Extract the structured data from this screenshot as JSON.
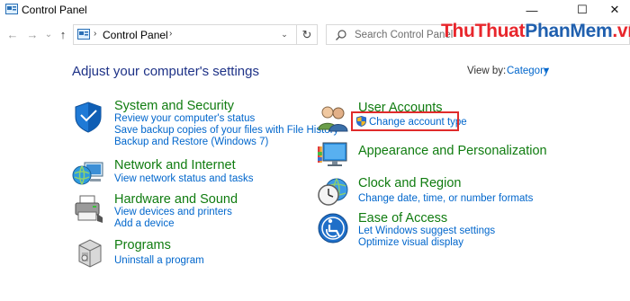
{
  "window": {
    "title": "Control Panel",
    "minimize": "—",
    "maximize": "☐",
    "close": "✕"
  },
  "nav": {
    "back": "←",
    "forward": "→",
    "history": "⌄",
    "up": "↑",
    "breadcrumb": "Control Panel",
    "separator1": "›",
    "separator2": "›",
    "dropdown": "⌄",
    "refresh": "↻"
  },
  "search": {
    "placeholder": "Search Control Panel"
  },
  "watermark": {
    "part1": "ThuThuat",
    "part2": "PhanMem",
    "part3": ".vn"
  },
  "main": {
    "heading": "Adjust your computer's settings",
    "view_by_label": "View by:",
    "view_by_value": "Category",
    "view_by_arrow": "▼"
  },
  "categories": [
    {
      "title": "System and Security",
      "icon": "shield-icon",
      "links": [
        "Review your computer's status",
        "Save backup copies of your files with File History",
        "Backup and Restore (Windows 7)"
      ]
    },
    {
      "title": "Network and Internet",
      "icon": "network-globe-icon",
      "links": [
        "View network status and tasks"
      ]
    },
    {
      "title": "Hardware and Sound",
      "icon": "printer-icon",
      "links": [
        "View devices and printers",
        "Add a device"
      ]
    },
    {
      "title": "Programs",
      "icon": "programs-box-icon",
      "links": [
        "Uninstall a program"
      ]
    },
    {
      "title": "User Accounts",
      "icon": "users-icon",
      "links": [
        "Change account type"
      ]
    },
    {
      "title": "Appearance and Personalization",
      "icon": "monitor-palette-icon",
      "links": []
    },
    {
      "title": "Clock and Region",
      "icon": "clock-globe-icon",
      "links": [
        "Change date, time, or number formats"
      ]
    },
    {
      "title": "Ease of Access",
      "icon": "accessibility-icon",
      "links": [
        "Let Windows suggest settings",
        "Optimize visual display"
      ]
    }
  ],
  "colors": {
    "heading": "#1e3287",
    "category_title": "#107c10",
    "link": "#0066cc",
    "highlight_border": "#e02b2b",
    "watermark_red": "#e8262c",
    "watermark_blue": "#1f5fae"
  }
}
